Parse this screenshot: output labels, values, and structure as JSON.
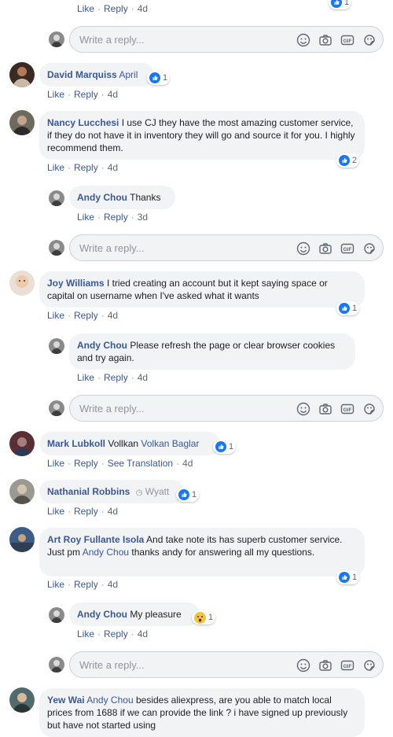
{
  "top_partial": {
    "actions": [
      "Like",
      "Reply"
    ],
    "time": "4d",
    "reaction_count": "1"
  },
  "reply_placeholder": "Write a reply...",
  "comments": [
    {
      "id": "david",
      "name": "David Marquiss",
      "mention": "April",
      "text": "",
      "actions": [
        "Like",
        "Reply"
      ],
      "time": "4d",
      "reaction_count": "1"
    },
    {
      "id": "nancy",
      "name": "Nancy Lucchesi",
      "text": "I use CJ they have the most amazing customer service, if they do not have it in inventory they will go and source it for you. I highly recommend them.",
      "actions": [
        "Like",
        "Reply"
      ],
      "time": "4d",
      "reaction_count": "2"
    },
    {
      "id": "andy1",
      "name": "Andy Chou",
      "text": "Thanks",
      "actions": [
        "Like",
        "Reply"
      ],
      "time": "3d"
    },
    {
      "id": "joy",
      "name": "Joy Williams",
      "text": "I tried creating an account but it kept saying space or capital on username when I've asked what it wants",
      "actions": [
        "Like",
        "Reply"
      ],
      "time": "4d",
      "reaction_count": "1"
    },
    {
      "id": "andy2",
      "name": "Andy Chou",
      "text": "Please refresh the page or clear browser cookies and try again.",
      "actions": [
        "Like",
        "Reply"
      ],
      "time": "4d"
    },
    {
      "id": "mark",
      "name": "Mark Lubkoll",
      "text": "Vollkan",
      "mention": "Volkan Baglar",
      "actions": [
        "Like",
        "Reply",
        "See Translation"
      ],
      "time": "4d",
      "reaction_count": "1"
    },
    {
      "id": "nathanial",
      "name": "Nathanial Robbins",
      "mention": "Wyatt",
      "actions": [
        "Like",
        "Reply"
      ],
      "time": "4d",
      "reaction_count": "1"
    },
    {
      "id": "art",
      "name": "Art Roy Fullante Isola",
      "text_before": "And take note its has superb customer service. Just pm",
      "mention": "Andy Chou",
      "text_after": "thanks andy for answering all my questions.",
      "actions": [
        "Like",
        "Reply"
      ],
      "time": "4d",
      "reaction_count": "1"
    },
    {
      "id": "andy3",
      "name": "Andy Chou",
      "text": "My pleasure",
      "actions": [
        "Like",
        "Reply"
      ],
      "time": "4d",
      "reaction_count": "1"
    },
    {
      "id": "yew",
      "name": "Yew Wai",
      "mention": "Andy Chou",
      "text": "besides aliexpress, are you able to match local prices from 1688 if we can provide the link ? i have signed up previously but have not started using"
    }
  ],
  "colors": {
    "link": "#385898",
    "bubble": "#f2f3f5",
    "like_blue": "#1877f2",
    "meta_gray": "#616770"
  },
  "icons": [
    "emoji-icon",
    "camera-icon",
    "gif-icon",
    "sticker-icon",
    "like-reaction-icon",
    "wow-reaction-icon"
  ]
}
